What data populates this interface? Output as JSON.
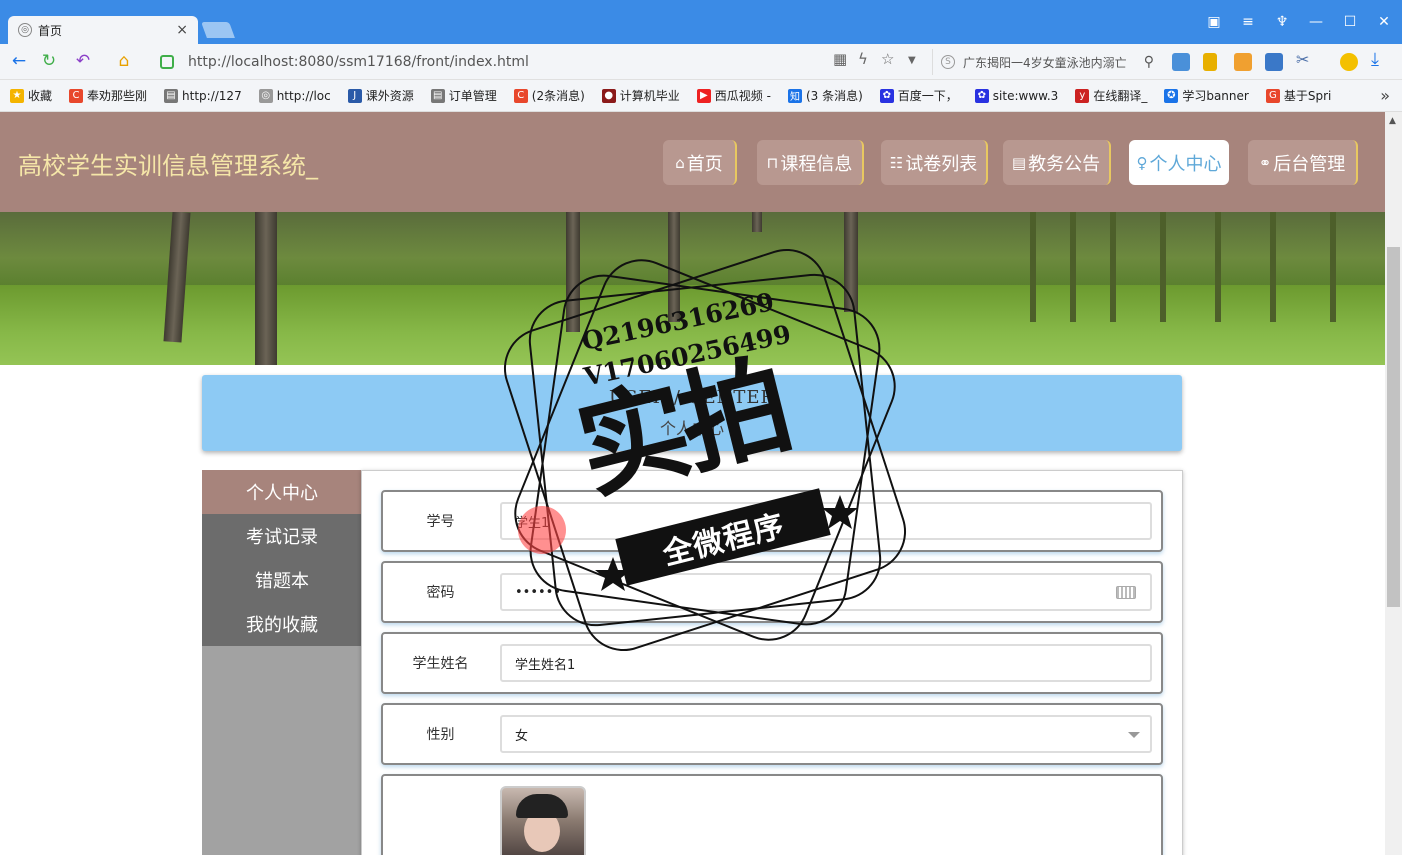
{
  "browser": {
    "tab_title": "首页",
    "tab_close": "×",
    "url": "http://localhost:8080/ssm17168/front/index.html",
    "search_text": "广东揭阳一4岁女童泳池内溺亡",
    "bookmarks": [
      {
        "label": "收藏",
        "color": "#f4b400",
        "glyph": "★"
      },
      {
        "label": "奉劝那些刚",
        "color": "#e8472c",
        "glyph": "C"
      },
      {
        "label": "http://127",
        "color": "#777",
        "glyph": "▤"
      },
      {
        "label": "http://loc",
        "color": "#999",
        "glyph": "◎"
      },
      {
        "label": "课外资源",
        "color": "#2a5aa8",
        "glyph": "J"
      },
      {
        "label": "订单管理",
        "color": "#777",
        "glyph": "▤"
      },
      {
        "label": "(2条消息)",
        "color": "#e8472c",
        "glyph": "C"
      },
      {
        "label": "计算机毕业",
        "color": "#8b1a1a",
        "glyph": "●"
      },
      {
        "label": "西瓜视频 -",
        "color": "#e22",
        "glyph": "▶"
      },
      {
        "label": "(3 条消息)",
        "color": "#1a73e8",
        "glyph": "知"
      },
      {
        "label": "百度一下，",
        "color": "#2932e1",
        "glyph": "✿"
      },
      {
        "label": "site:www.3",
        "color": "#2932e1",
        "glyph": "✿"
      },
      {
        "label": "在线翻译_",
        "color": "#c22",
        "glyph": "y"
      },
      {
        "label": "学习banner",
        "color": "#1a73e8",
        "glyph": "✪"
      },
      {
        "label": "基于Spri",
        "color": "#e8472c",
        "glyph": "G"
      }
    ]
  },
  "site": {
    "title": "高校学生实训信息管理系统_",
    "nav": [
      {
        "label": "首页",
        "icon": "⌂"
      },
      {
        "label": "课程信息",
        "icon": "⊓"
      },
      {
        "label": "试卷列表",
        "icon": "☷"
      },
      {
        "label": "教务公告",
        "icon": "▤"
      },
      {
        "label": "个人中心",
        "icon": "♀"
      },
      {
        "label": "后台管理",
        "icon": "⚭"
      }
    ],
    "active_nav": "个人中心"
  },
  "center_heading": {
    "en": "USER / CENTER",
    "zh": "个人中心"
  },
  "side_menu": [
    "个人中心",
    "考试记录",
    "错题本",
    "我的收藏"
  ],
  "form": {
    "student_no": {
      "label": "学号",
      "value": "学生1"
    },
    "password": {
      "label": "密码",
      "value": "••••••"
    },
    "student_name": {
      "label": "学生姓名",
      "value": "学生姓名1"
    },
    "gender": {
      "label": "性别",
      "value": "女"
    }
  },
  "watermark": {
    "qq": "Q2196316269",
    "wx": "V17060256499",
    "big": "实拍",
    "ribbon": "全微程序"
  }
}
